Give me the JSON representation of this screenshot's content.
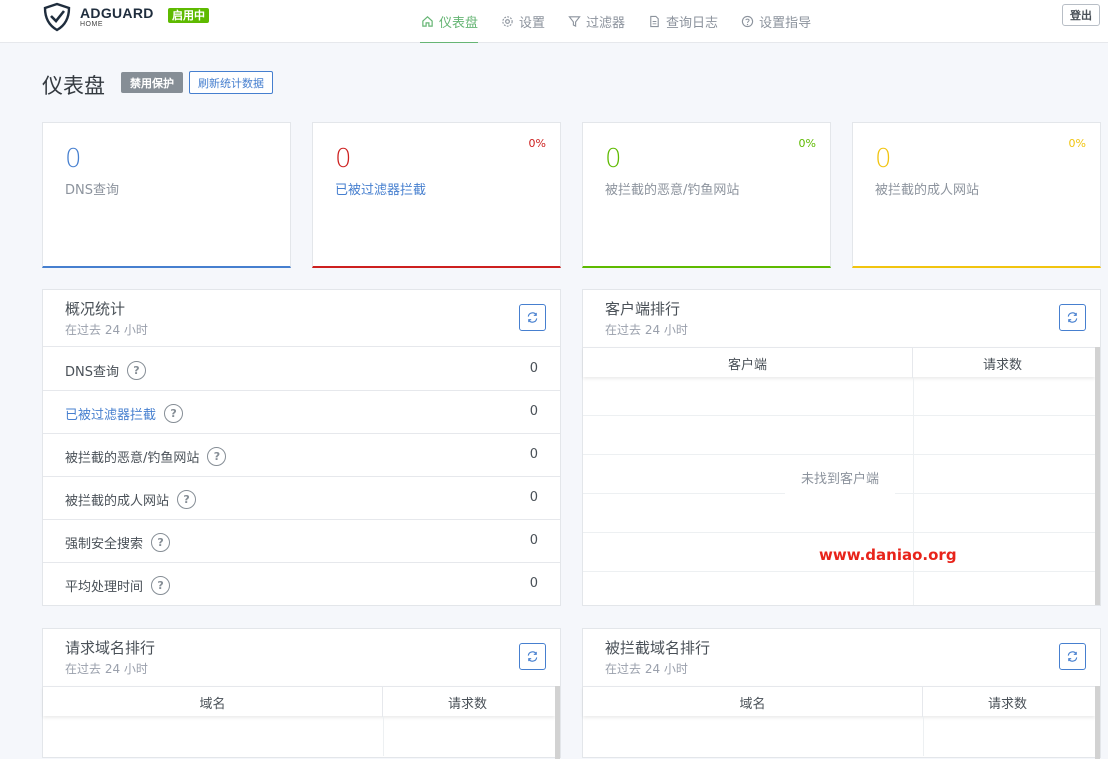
{
  "header": {
    "logo_main": "ADGUARD",
    "logo_sub": "HOME",
    "status": "启用中",
    "logout": "登出",
    "nav": [
      {
        "label": "仪表盘",
        "icon": "home-icon",
        "active": true
      },
      {
        "label": "设置",
        "icon": "gear-icon",
        "active": false
      },
      {
        "label": "过滤器",
        "icon": "filter-icon",
        "active": false
      },
      {
        "label": "查询日志",
        "icon": "document-icon",
        "active": false
      },
      {
        "label": "设置指导",
        "icon": "help-circle-icon",
        "active": false
      }
    ]
  },
  "page": {
    "title": "仪表盘",
    "disable_btn": "禁用保护",
    "refresh_btn": "刷新统计数据"
  },
  "stat_cards": [
    {
      "value": "0",
      "label": "DNS查询",
      "percent": "",
      "color": "#467fcf"
    },
    {
      "value": "0",
      "label": "已被过滤器拦截",
      "percent": "0%",
      "color": "#cd201f"
    },
    {
      "value": "0",
      "label": "被拦截的恶意/钓鱼网站",
      "percent": "0%",
      "color": "#5eba00"
    },
    {
      "value": "0",
      "label": "被拦截的成人网站",
      "percent": "0%",
      "color": "#f1c40f"
    }
  ],
  "overview": {
    "title": "概况统计",
    "subtitle": "在过去 24 小时",
    "rows": [
      {
        "label": "DNS查询",
        "value": "0"
      },
      {
        "label": "已被过滤器拦截",
        "value": "0"
      },
      {
        "label": "被拦截的恶意/钓鱼网站",
        "value": "0"
      },
      {
        "label": "被拦截的成人网站",
        "value": "0"
      },
      {
        "label": "强制安全搜索",
        "value": "0"
      },
      {
        "label": "平均处理时间",
        "value": "0"
      }
    ]
  },
  "clients": {
    "title": "客户端排行",
    "subtitle": "在过去 24 小时",
    "col1": "客户端",
    "col2": "请求数",
    "empty": "未找到客户端"
  },
  "queried_domains": {
    "title": "请求域名排行",
    "subtitle": "在过去 24 小时",
    "col1": "域名",
    "col2": "请求数"
  },
  "blocked_domains": {
    "title": "被拦截域名排行",
    "subtitle": "在过去 24 小时",
    "col1": "域名",
    "col2": "请求数"
  },
  "watermark": "www.daniao.org"
}
